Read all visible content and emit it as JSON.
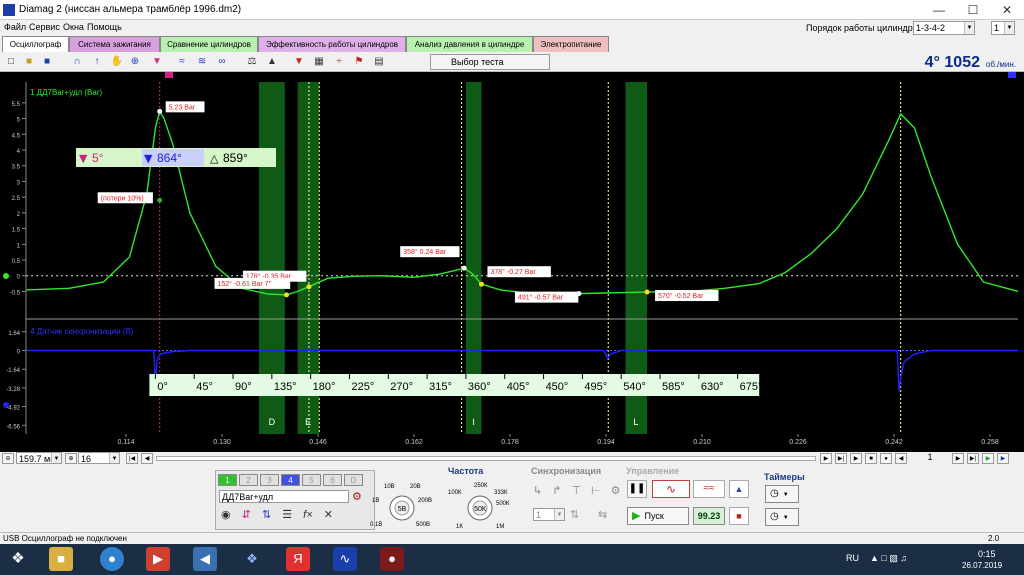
{
  "window": {
    "title": "Diamag 2 (ниссан альмера трамблёр 1996.dm2)"
  },
  "menu": [
    "Файл",
    "Сервис",
    "Окна",
    "Помощь"
  ],
  "cylinder_order": {
    "label": "Порядок работы цилиндров",
    "value": "1-3-4-2",
    "count": "1"
  },
  "tabs": [
    {
      "label": "Осциллограф",
      "color": "#ffffff"
    },
    {
      "label": "Система зажигания",
      "color": "#d9a0e0"
    },
    {
      "label": "Сравнение цилиндров",
      "color": "#b8f0b0"
    },
    {
      "label": "Эффективность работы цилиндров",
      "color": "#e0b0e8"
    },
    {
      "label": "Анализ давления в цилиндре",
      "color": "#b8f0b0"
    },
    {
      "label": "Электропитание",
      "color": "#f0c0c0"
    }
  ],
  "toolbar": {
    "test_select": "Выбор теста"
  },
  "rpm": {
    "angle": "4°",
    "value": "1052",
    "unit": "об./мин."
  },
  "scope": {
    "ch1_label": "1 ДД7Bar+удл (Bar)",
    "ch4_label": "4 Датчик синхронизации (В)",
    "ch1_ticks": [
      "5.5",
      "5",
      "4.5",
      "4",
      "3.5",
      "3",
      "2.5",
      "2",
      "1.5",
      "1",
      "0.5",
      "0",
      "-0.5"
    ],
    "ch4_ticks": [
      "-6.56",
      "-4.92",
      "-3.28",
      "-1.64",
      "0",
      "1.64"
    ],
    "time_ticks": [
      "0.114",
      "0.130",
      "0.146",
      "0.162",
      "0.178",
      "0.194",
      "0.210",
      "0.226",
      "0.242",
      "0.258"
    ],
    "angle_ticks": [
      "0°",
      "45°",
      "90°",
      "135°",
      "180°",
      "225°",
      "270°",
      "315°",
      "360°",
      "405°",
      "450°",
      "495°",
      "540°",
      "585°",
      "630°",
      "675°"
    ],
    "strokes": [
      "D",
      "E",
      "I",
      "L"
    ],
    "cursor": {
      "marker_a": "5°",
      "marker_b": "864°",
      "delta": "859°"
    },
    "markers": [
      {
        "text": "5.23 Bar",
        "x": 5,
        "y": 5.23
      },
      {
        "text": "(потери 10%)",
        "x": 5,
        "y": 2.4
      },
      {
        "text": "178° -0.35 Bar",
        "x": 178,
        "y": -0.35
      },
      {
        "text": "152° -0.61 Bar 7°",
        "x": 152,
        "y": -0.61
      },
      {
        "text": "358° 0.24 Bar",
        "x": 358,
        "y": 0.24
      },
      {
        "text": "378° -0.27 Bar",
        "x": 378,
        "y": -0.27
      },
      {
        "text": "491° -0.57 Bar",
        "x": 491,
        "y": -0.57
      },
      {
        "text": "570° -0.52 Bar",
        "x": 570,
        "y": -0.52
      }
    ]
  },
  "chart_data": {
    "type": "line",
    "series": [
      {
        "name": "1 ДД7Bar+удл (Bar)",
        "color": "#2ee82e",
        "x": [
          -150,
          -100,
          -60,
          -30,
          -10,
          0,
          5,
          10,
          20,
          40,
          70,
          100,
          130,
          152,
          165,
          178,
          200,
          230,
          260,
          300,
          330,
          358,
          368,
          378,
          400,
          430,
          460,
          491,
          520,
          570,
          620,
          660,
          700,
          730,
          760,
          790,
          820,
          850,
          864,
          880,
          900,
          930,
          960,
          1000
        ],
        "y": [
          -0.45,
          -0.4,
          -0.2,
          0.6,
          2.6,
          4.7,
          5.23,
          5,
          4.2,
          2.0,
          0.3,
          -0.4,
          -0.58,
          -0.61,
          -0.5,
          -0.35,
          -0.08,
          -0.02,
          0.0,
          -0.05,
          0.05,
          0.24,
          0.05,
          -0.27,
          -0.45,
          -0.55,
          -0.57,
          -0.57,
          -0.55,
          -0.52,
          -0.5,
          -0.4,
          -0.25,
          0.1,
          0.7,
          1.5,
          2.6,
          4.3,
          5.15,
          4.7,
          3.1,
          1.0,
          -0.2,
          -0.5
        ]
      },
      {
        "name": "4 Датчик синхронизации (В)",
        "color": "#2020ff",
        "x": [
          -150,
          -2,
          0,
          2,
          6,
          20,
          40,
          80,
          200,
          520,
          524,
          528,
          540,
          560,
          600,
          860,
          862,
          864,
          868,
          880,
          900,
          1000
        ],
        "y": [
          0,
          0,
          -2.9,
          -0.8,
          -0.3,
          -0.1,
          0,
          0,
          0,
          0,
          -0.7,
          -0.3,
          0,
          0,
          0,
          0,
          -3.6,
          -2.4,
          -1.0,
          -0.3,
          0,
          0
        ]
      }
    ],
    "xlim": [
      -150,
      1000
    ],
    "ylim_ch1": [
      -0.9,
      6.1
    ],
    "ylim_ch4": [
      -8.2,
      2.5
    ]
  },
  "navrow": {
    "timebase": "159.7 мс",
    "divs": "16",
    "page": "1"
  },
  "panel": {
    "channels": [
      "1",
      "2",
      "3",
      "4",
      "5",
      "6",
      "D"
    ],
    "sensor": "ДД7Bar+удл",
    "volt_label": "5В",
    "volt_ticks": [
      "10В",
      "20В",
      "1В",
      "200В",
      "0.1В",
      "500В"
    ],
    "freq_title": "Частота",
    "freq_value": "50К",
    "freq_ticks": [
      "100К",
      "250К",
      "333К",
      "500К",
      "1К",
      "1М"
    ],
    "sync_title": "Синхронизация",
    "sync_value": "1",
    "control_title": "Управление",
    "start": "Пуск",
    "value_box": "99.23",
    "timers_title": "Таймеры"
  },
  "status": {
    "left": "USB Осциллограф не подключен",
    "right": "2.0"
  },
  "taskbar": {
    "lang": "RU",
    "time": "0:15",
    "date": "26.07.2019"
  }
}
